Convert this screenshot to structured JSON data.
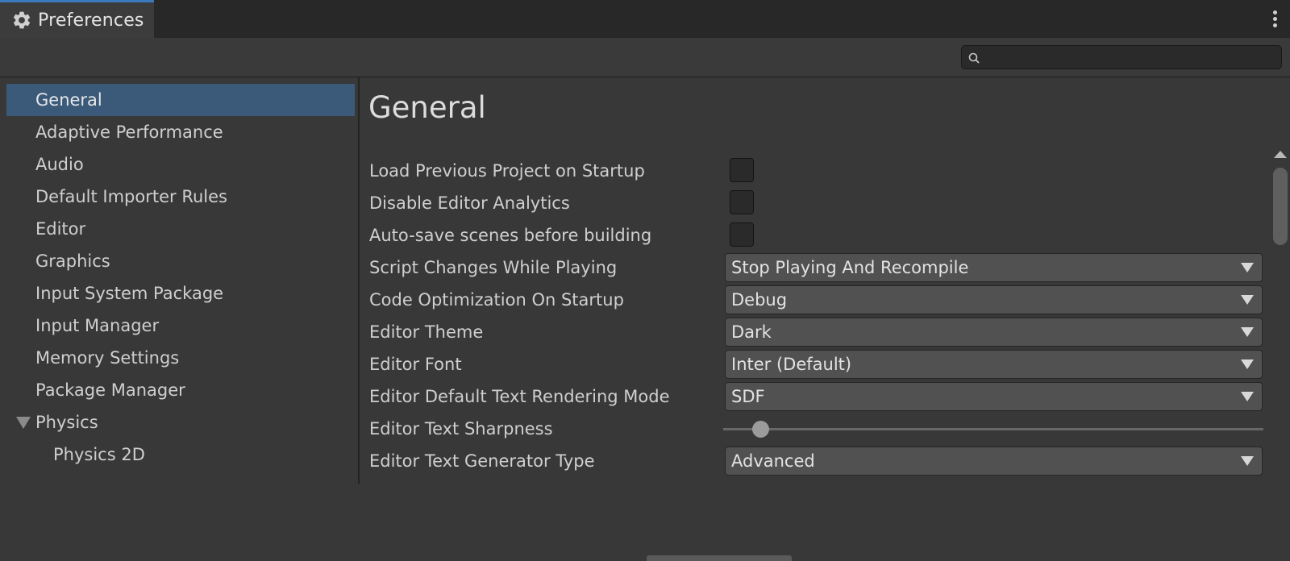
{
  "window": {
    "title": "Preferences",
    "icon": "gear-icon"
  },
  "search": {
    "placeholder": "",
    "value": "",
    "icon": "search-icon"
  },
  "sidebar": {
    "items": [
      {
        "label": "General",
        "selected": true
      },
      {
        "label": "Adaptive Performance"
      },
      {
        "label": "Audio"
      },
      {
        "label": "Default Importer Rules"
      },
      {
        "label": "Editor"
      },
      {
        "label": "Graphics"
      },
      {
        "label": "Input System Package"
      },
      {
        "label": "Input Manager"
      },
      {
        "label": "Memory Settings"
      },
      {
        "label": "Package Manager"
      },
      {
        "label": "Physics",
        "expanded": true
      },
      {
        "label": "Physics 2D",
        "child_of": "Physics"
      }
    ]
  },
  "main": {
    "title": "General",
    "settings": [
      {
        "label": "Load Previous Project on Startup",
        "type": "checkbox",
        "checked": false
      },
      {
        "label": "Disable Editor Analytics",
        "type": "checkbox",
        "checked": false
      },
      {
        "label": "Auto-save scenes before building",
        "type": "checkbox",
        "checked": false
      },
      {
        "label": "Script Changes While Playing",
        "type": "dropdown",
        "value": "Stop Playing And Recompile"
      },
      {
        "label": "Code Optimization On Startup",
        "type": "dropdown",
        "value": "Debug"
      },
      {
        "label": "Editor Theme",
        "type": "dropdown",
        "value": "Dark"
      },
      {
        "label": "Editor Font",
        "type": "dropdown",
        "value": "Inter (Default)"
      },
      {
        "label": "Editor Default Text Rendering Mode",
        "type": "dropdown",
        "value": "SDF"
      },
      {
        "label": "Editor Text Sharpness",
        "type": "slider",
        "level_fraction": 0.07
      },
      {
        "label": "Editor Text Generator Type",
        "type": "dropdown",
        "value": "Advanced"
      }
    ]
  },
  "colors": {
    "accent": "#3a79bb",
    "selection": "#3b5a7a",
    "background": "#383838",
    "titlebar": "#282828"
  }
}
